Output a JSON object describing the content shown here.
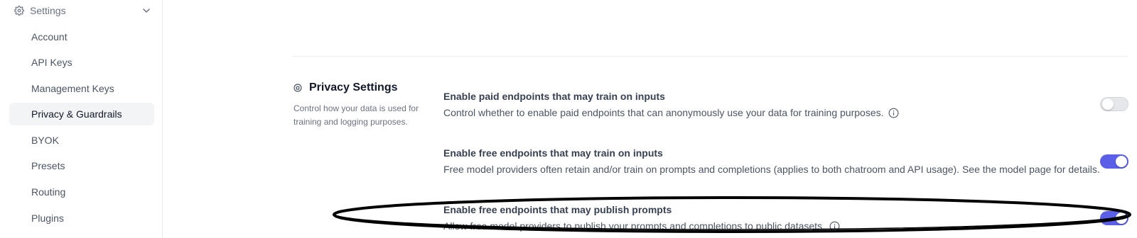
{
  "sidebar": {
    "section_label": "Settings",
    "section_icon": "gear-icon",
    "items": [
      {
        "label": "Account"
      },
      {
        "label": "API Keys"
      },
      {
        "label": "Management Keys"
      },
      {
        "label": "Privacy & Guardrails",
        "active": true
      },
      {
        "label": "BYOK"
      },
      {
        "label": "Presets"
      },
      {
        "label": "Routing"
      },
      {
        "label": "Plugins"
      }
    ]
  },
  "privacy": {
    "title": "Privacy Settings",
    "description": "Control how your data is used for training and logging purposes.",
    "settings": [
      {
        "title": "Enable paid endpoints that may train on inputs",
        "description": "Control whether to enable paid endpoints that can anonymously use your data for training purposes.",
        "has_info": true,
        "enabled": false
      },
      {
        "title": "Enable free endpoints that may train on inputs",
        "description": "Free model providers often retain and/or train on prompts and completions (applies to both chatroom and API usage). See the model page for details.",
        "has_info": false,
        "enabled": true
      },
      {
        "title": "Enable free endpoints that may publish prompts",
        "description": "Allow free model providers to publish your prompts and completions to public datasets.",
        "has_info": true,
        "enabled": true
      }
    ]
  },
  "colors": {
    "accent": "#5b5ee6",
    "active_bg": "#f3f4f6",
    "annotation": "#000000"
  }
}
